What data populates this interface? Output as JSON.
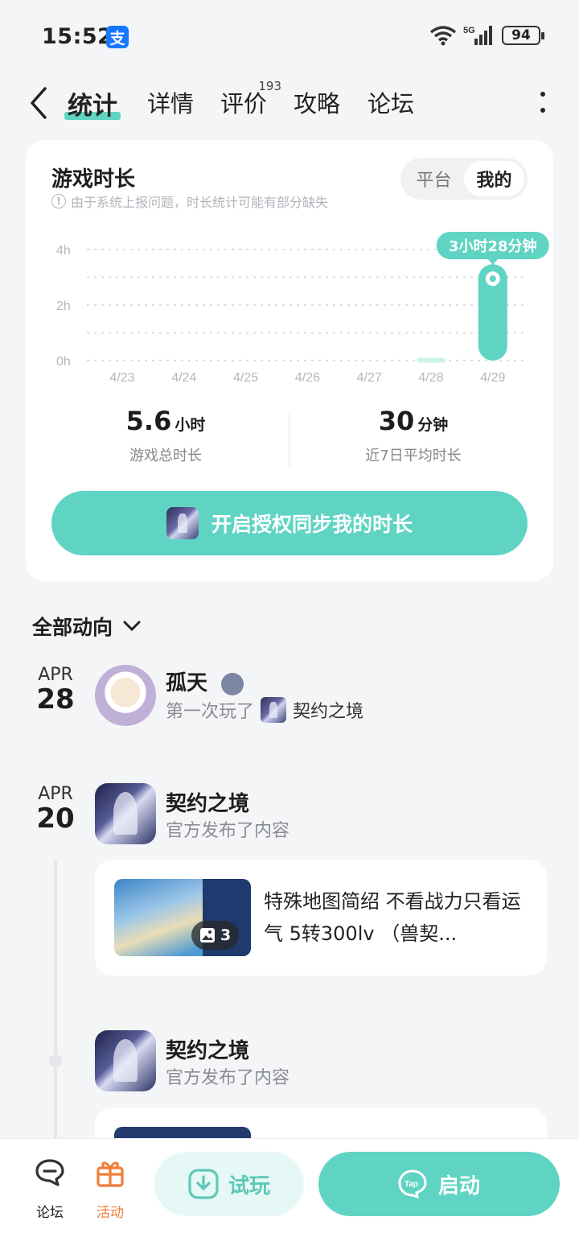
{
  "status_bar": {
    "time": "15:52",
    "app_badge": "支",
    "network": "5G",
    "battery": "94"
  },
  "tabs": [
    {
      "label": "统计",
      "active": true
    },
    {
      "label": "详情"
    },
    {
      "label": "评价",
      "count": "193"
    },
    {
      "label": "攻略"
    },
    {
      "label": "论坛"
    }
  ],
  "playtime": {
    "title": "游戏时长",
    "note": "由于系统上报问题，时长统计可能有部分缺失",
    "segment": [
      "平台",
      "我的"
    ],
    "total_value": "5.6",
    "total_unit": "小时",
    "total_label": "游戏总时长",
    "avg_value": "30",
    "avg_unit": "分钟",
    "avg_label": "近7日平均时长",
    "sync_button": "开启授权同步我的时长"
  },
  "chart_data": {
    "type": "bar",
    "categories": [
      "4/23",
      "4/24",
      "4/25",
      "4/26",
      "4/27",
      "4/28",
      "4/29"
    ],
    "values": [
      0,
      0,
      0,
      0,
      0,
      0.1,
      3.47
    ],
    "y_ticks": [
      "0h",
      "2h",
      "4h"
    ],
    "ylim": [
      0,
      4
    ],
    "highlight_label": "3小时28分钟",
    "accent": "#5fd4c3"
  },
  "feed": {
    "filter_label": "全部动向",
    "entries": [
      {
        "month": "APR",
        "day": "28",
        "name": "孤天",
        "action": "第一次玩了",
        "game": "契约之境"
      },
      {
        "month": "APR",
        "day": "20",
        "name": "契约之境",
        "action": "官方发布了内容",
        "post": {
          "title": "特殊地图简绍 不看战力只看运气 5转300lv （兽契...",
          "image_count": "3"
        }
      },
      {
        "name": "契约之境",
        "action": "官方发布了内容"
      }
    ]
  },
  "bottom_bar": {
    "forum": "论坛",
    "activity": "活动",
    "try": "试玩",
    "launch": "启动"
  }
}
